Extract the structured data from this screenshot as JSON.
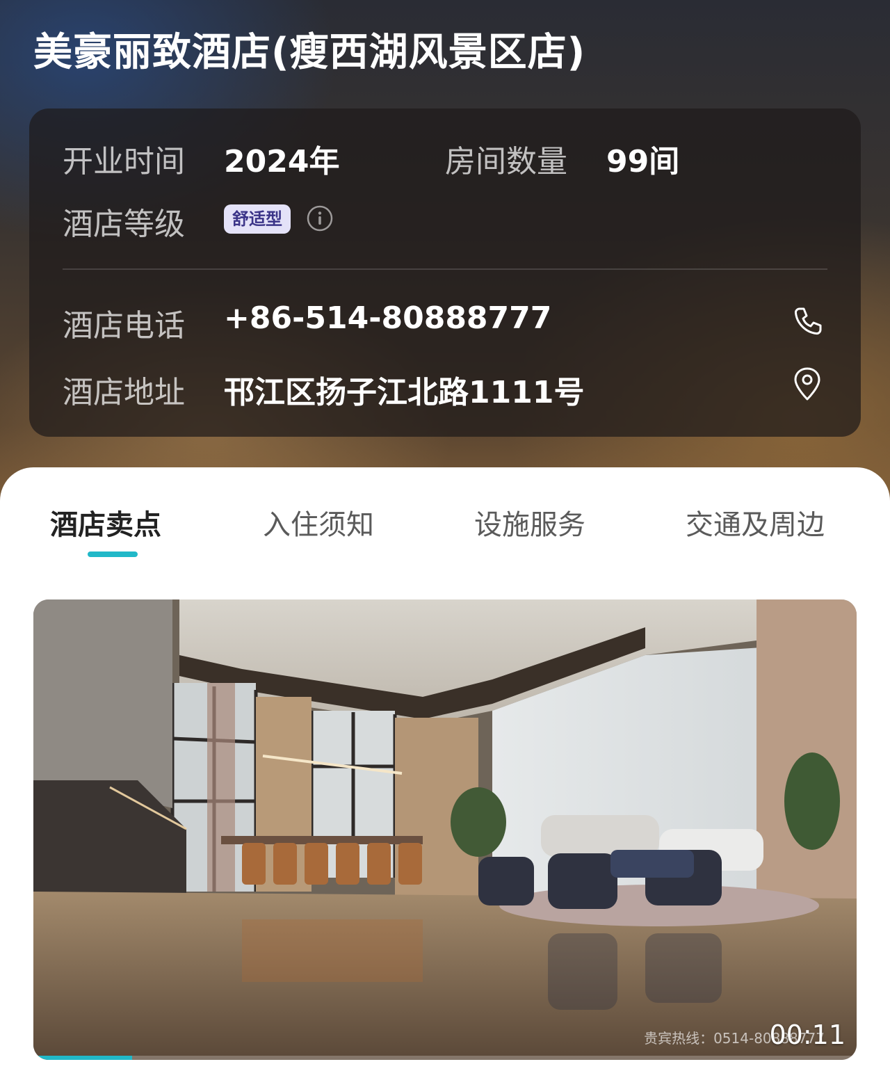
{
  "hotel": {
    "title": "美豪丽致酒店(瘦西湖风景区店)"
  },
  "info": {
    "opening_label": "开业时间",
    "opening_value": "2024年",
    "rooms_label": "房间数量",
    "rooms_value": "99间",
    "grade_label": "酒店等级",
    "grade_badge": "舒适型",
    "phone_label": "酒店电话",
    "phone_value": "+86-514-80888777",
    "address_label": "酒店地址",
    "address_value": "邗江区扬子江北路1111号"
  },
  "icons": {
    "grade_info": "info-circle-icon",
    "phone": "phone-icon",
    "location": "location-pin-icon"
  },
  "tabs": [
    {
      "label": "酒店卖点",
      "active": true
    },
    {
      "label": "入住须知",
      "active": false
    },
    {
      "label": "设施服务",
      "active": false
    },
    {
      "label": "交通及周边",
      "active": false
    }
  ],
  "video": {
    "watermark": "贵宾热线：0514-80888777",
    "timestamp": "00:11",
    "progress": 0.12
  },
  "colors": {
    "accent": "#21b8c8",
    "badge_bg": "#e4e2f8",
    "badge_text": "#3b3488"
  }
}
